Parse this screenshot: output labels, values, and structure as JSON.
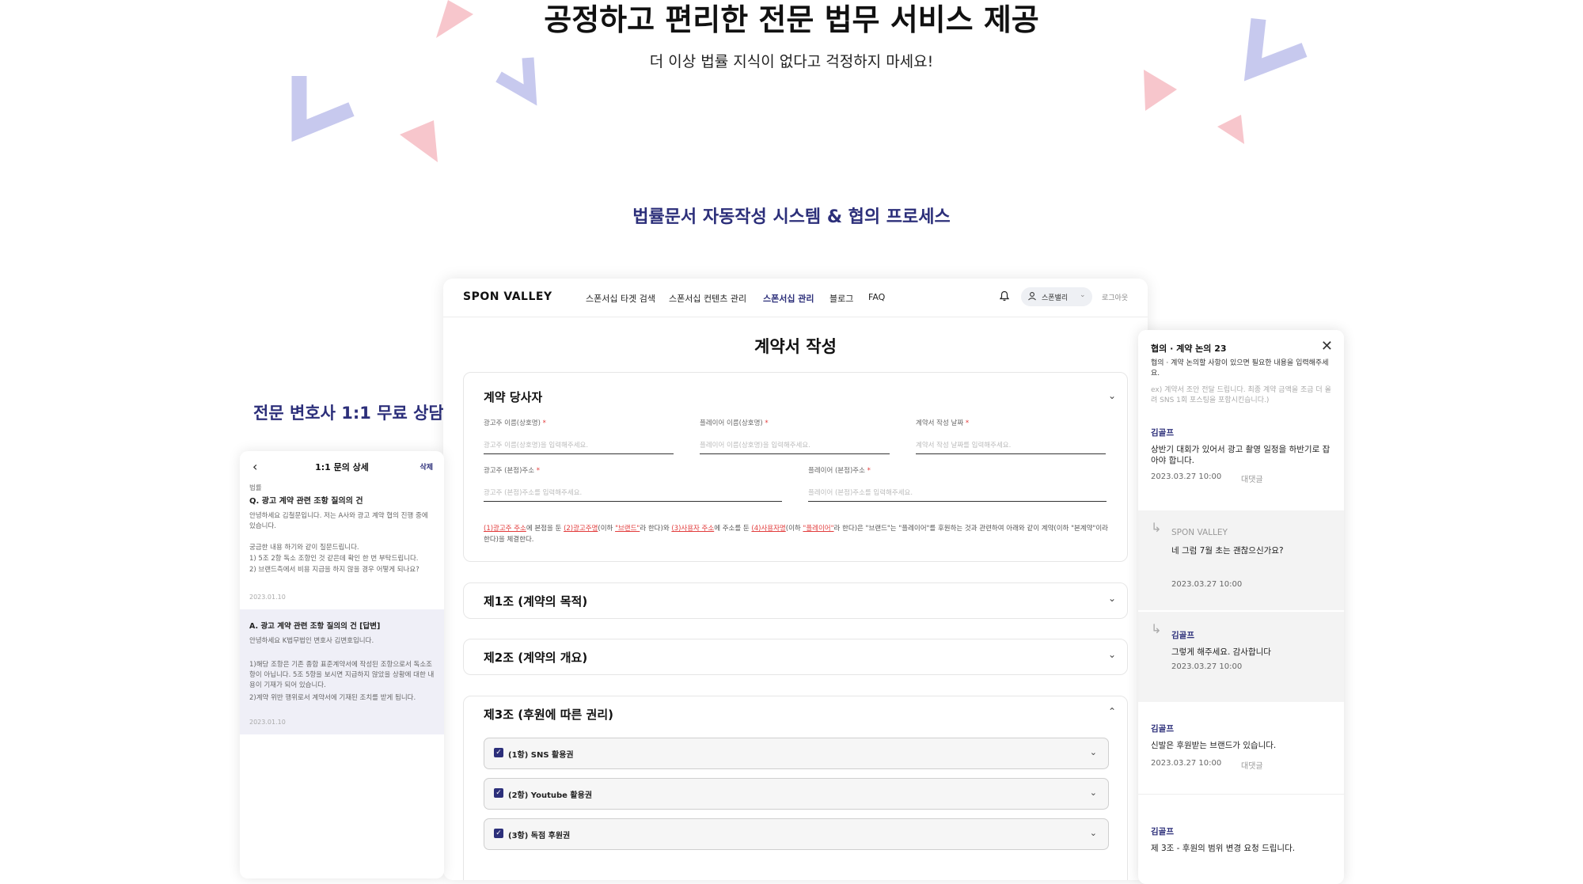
{
  "hero": {
    "title": "공정하고 편리한 전문 법무 서비스 제공",
    "subtitle": "더 이상 법률 지식이 없다고 걱정하지 마세요!"
  },
  "section": {
    "title": "법률문서 자동작성 시스템 & 협의 프로세스",
    "side_title": "전문 변호사 1:1 무료 상담"
  },
  "colors": {
    "accent": "#2c2f7a",
    "deco_pink": "#f7c6cc",
    "deco_lavender": "#c7c9ee",
    "required": "#e23b3b"
  },
  "nav": {
    "logo": "SPON VALLEY",
    "items": [
      "스폰서십 타겟 검색",
      "스폰서십 컨텐츠 관리",
      "스폰서십 관리",
      "블로그",
      "FAQ"
    ],
    "active_index": 2,
    "user": "스폰밸리",
    "logout": "로그아웃",
    "icons": [
      "bell-icon",
      "user-icon",
      "chevron-down-icon"
    ]
  },
  "form": {
    "title": "계약서 작성",
    "parties": {
      "title": "계약 당사자",
      "fields": [
        {
          "label": "광고주 이름(상호명)",
          "placeholder": "광고주 이름(상호명)을 입력해주세요."
        },
        {
          "label": "플레이어 이름(상호명)",
          "placeholder": "플레이어 이름(상호명)을 입력해주세요."
        },
        {
          "label": "계약서 작성 날짜",
          "placeholder": "계약서 작성 날짜를 입력해주세요."
        },
        {
          "label": "광고주 (본점)주소",
          "placeholder": "광고주 (본점)주소를 입력해주세요."
        },
        {
          "label": "플레이어 (본점)주소",
          "placeholder": "플레이어 (본점)주소를 입력해주세요."
        }
      ],
      "required_mark": "*",
      "clause": {
        "p1": "(1)광고주 주소",
        "t1": "에 본점을 둔 ",
        "p2": "(2)광고주명",
        "t2": "(이하 ",
        "p3": "\"브랜드\"",
        "t3": "라 한다)와 ",
        "p4": "(3)사용자 주소",
        "t4": "에 주소를 둔 ",
        "p5": "(4)사용자명",
        "t5": "(이하 ",
        "p6": "\"플레이어\"",
        "t6": "라 한다)은 \"브랜드\"는 \"플레이어\"를 후원하는 것과 관련하여 아래와 같이 계약(이하 \"본계약\"이라 한다)을 체결한다."
      }
    },
    "articles": [
      {
        "title": "제1조 (계약의 목적)",
        "expanded": false
      },
      {
        "title": "제2조 (계약의 개요)",
        "expanded": false
      },
      {
        "title": "제3조 (후원에 따른 권리)",
        "expanded": true
      }
    ],
    "sub_items": [
      {
        "label": "(1항) SNS 활용권",
        "checked": true
      },
      {
        "label": "(2항) Youtube 활용권",
        "checked": true
      },
      {
        "label": "(3항) 독점 후원권",
        "checked": true
      }
    ]
  },
  "inquiry": {
    "back": "‹",
    "title": "1:1 문의 상세",
    "delete": "삭제",
    "category": "법률",
    "question": "Q. 광고 계약 관련 조항 질의의 건",
    "body_1": "안녕하세요 김철문입니다. 저는 A사와 광고 계약 협의 진행 중에 있습니다.",
    "body_2": "궁금한 내용 하기와 같이 질문드립니다.",
    "body_3": "1) 5조 2항 독소 조항인 것 같은데 확인 한 번 부탁드립니다.",
    "body_4": "2) 브랜드측에서 비용 지급을 하지 않을 경우 어떻게 되나요?",
    "date": "2023.01.10",
    "answer_title": "A. 광고 계약 관련 조항 질의의 건 [답변]",
    "answer_1": "안녕하세요 K법무법인 변호사 김변호입니다.",
    "answer_2": "1)해당 조항은 기존 종합 표준계약서에 작성된 조항으로서 독소조항이 아닙니다. 5조 5항을 보시면 지급하지 않았을 상황에 대한 내용이 기재가 되어 있습니다.",
    "answer_3": "2)계약 위반 행위로서 계약서에 기재된 조치를 받게 됩니다.",
    "answer_date": "2023.01.10"
  },
  "chat": {
    "title": "협의 · 계약 논의 23",
    "close": "✕",
    "desc": "협의 · 계약 논의할 사항이 있으면 필요한 내용을 입력해주세요.",
    "hint": "ex) 계약서 조안 전달 드립니다. 최종 계약 금액을 조금 더 올려 SNS 1회 포스팅을 포함시킨습니다.)",
    "reply_label": "대댓글",
    "messages": [
      {
        "author": "김골프",
        "text": "상반기 대회가 있어서 광고 촬영 일정을 하반기로 잡아야 합니다.",
        "time": "2023.03.27 10:00",
        "reply": true
      },
      {
        "author": "SPON VALLEY",
        "text": "네 그럼 7월 초는 괜찮으신가요?",
        "time": "2023.03.27 10:00",
        "nested": true
      },
      {
        "author": "김골프",
        "text": "그렇게 해주세요. 감사합니다",
        "time": "2023.03.27 10:00",
        "nested": true
      },
      {
        "author": "김골프",
        "text": "신발은 후원받는 브랜드가 있습니다.",
        "time": "2023.03.27 10:00",
        "reply": true
      },
      {
        "author": "김골프",
        "text": "제 3조 - 후원의 범위 변경 요청 드립니다."
      }
    ]
  }
}
